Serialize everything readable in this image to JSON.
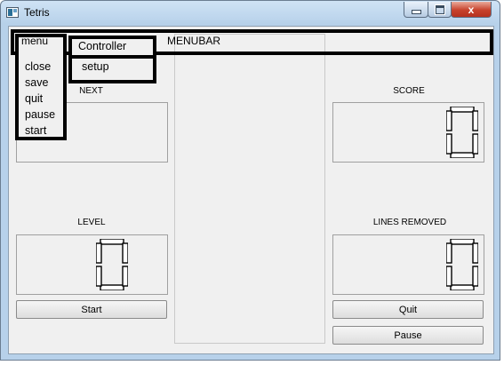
{
  "window": {
    "title": "Tetris"
  },
  "titlebar_buttons": {
    "minimize": "",
    "maximize": "",
    "close": "x"
  },
  "labels": {
    "menubar": "MENUBAR",
    "next": "NEXT",
    "score": "SCORE",
    "level": "LEVEL",
    "lines_removed": "LINES REMOVED"
  },
  "displays": {
    "score": 0,
    "level": 0,
    "lines_removed": 0
  },
  "buttons": {
    "start": "Start",
    "quit": "Quit",
    "pause": "Pause"
  },
  "menu": {
    "title": "menu",
    "items": [
      "close",
      "save",
      "quit",
      "pause",
      "start"
    ]
  },
  "submenu": {
    "items": [
      "Controller",
      "setup"
    ]
  }
}
